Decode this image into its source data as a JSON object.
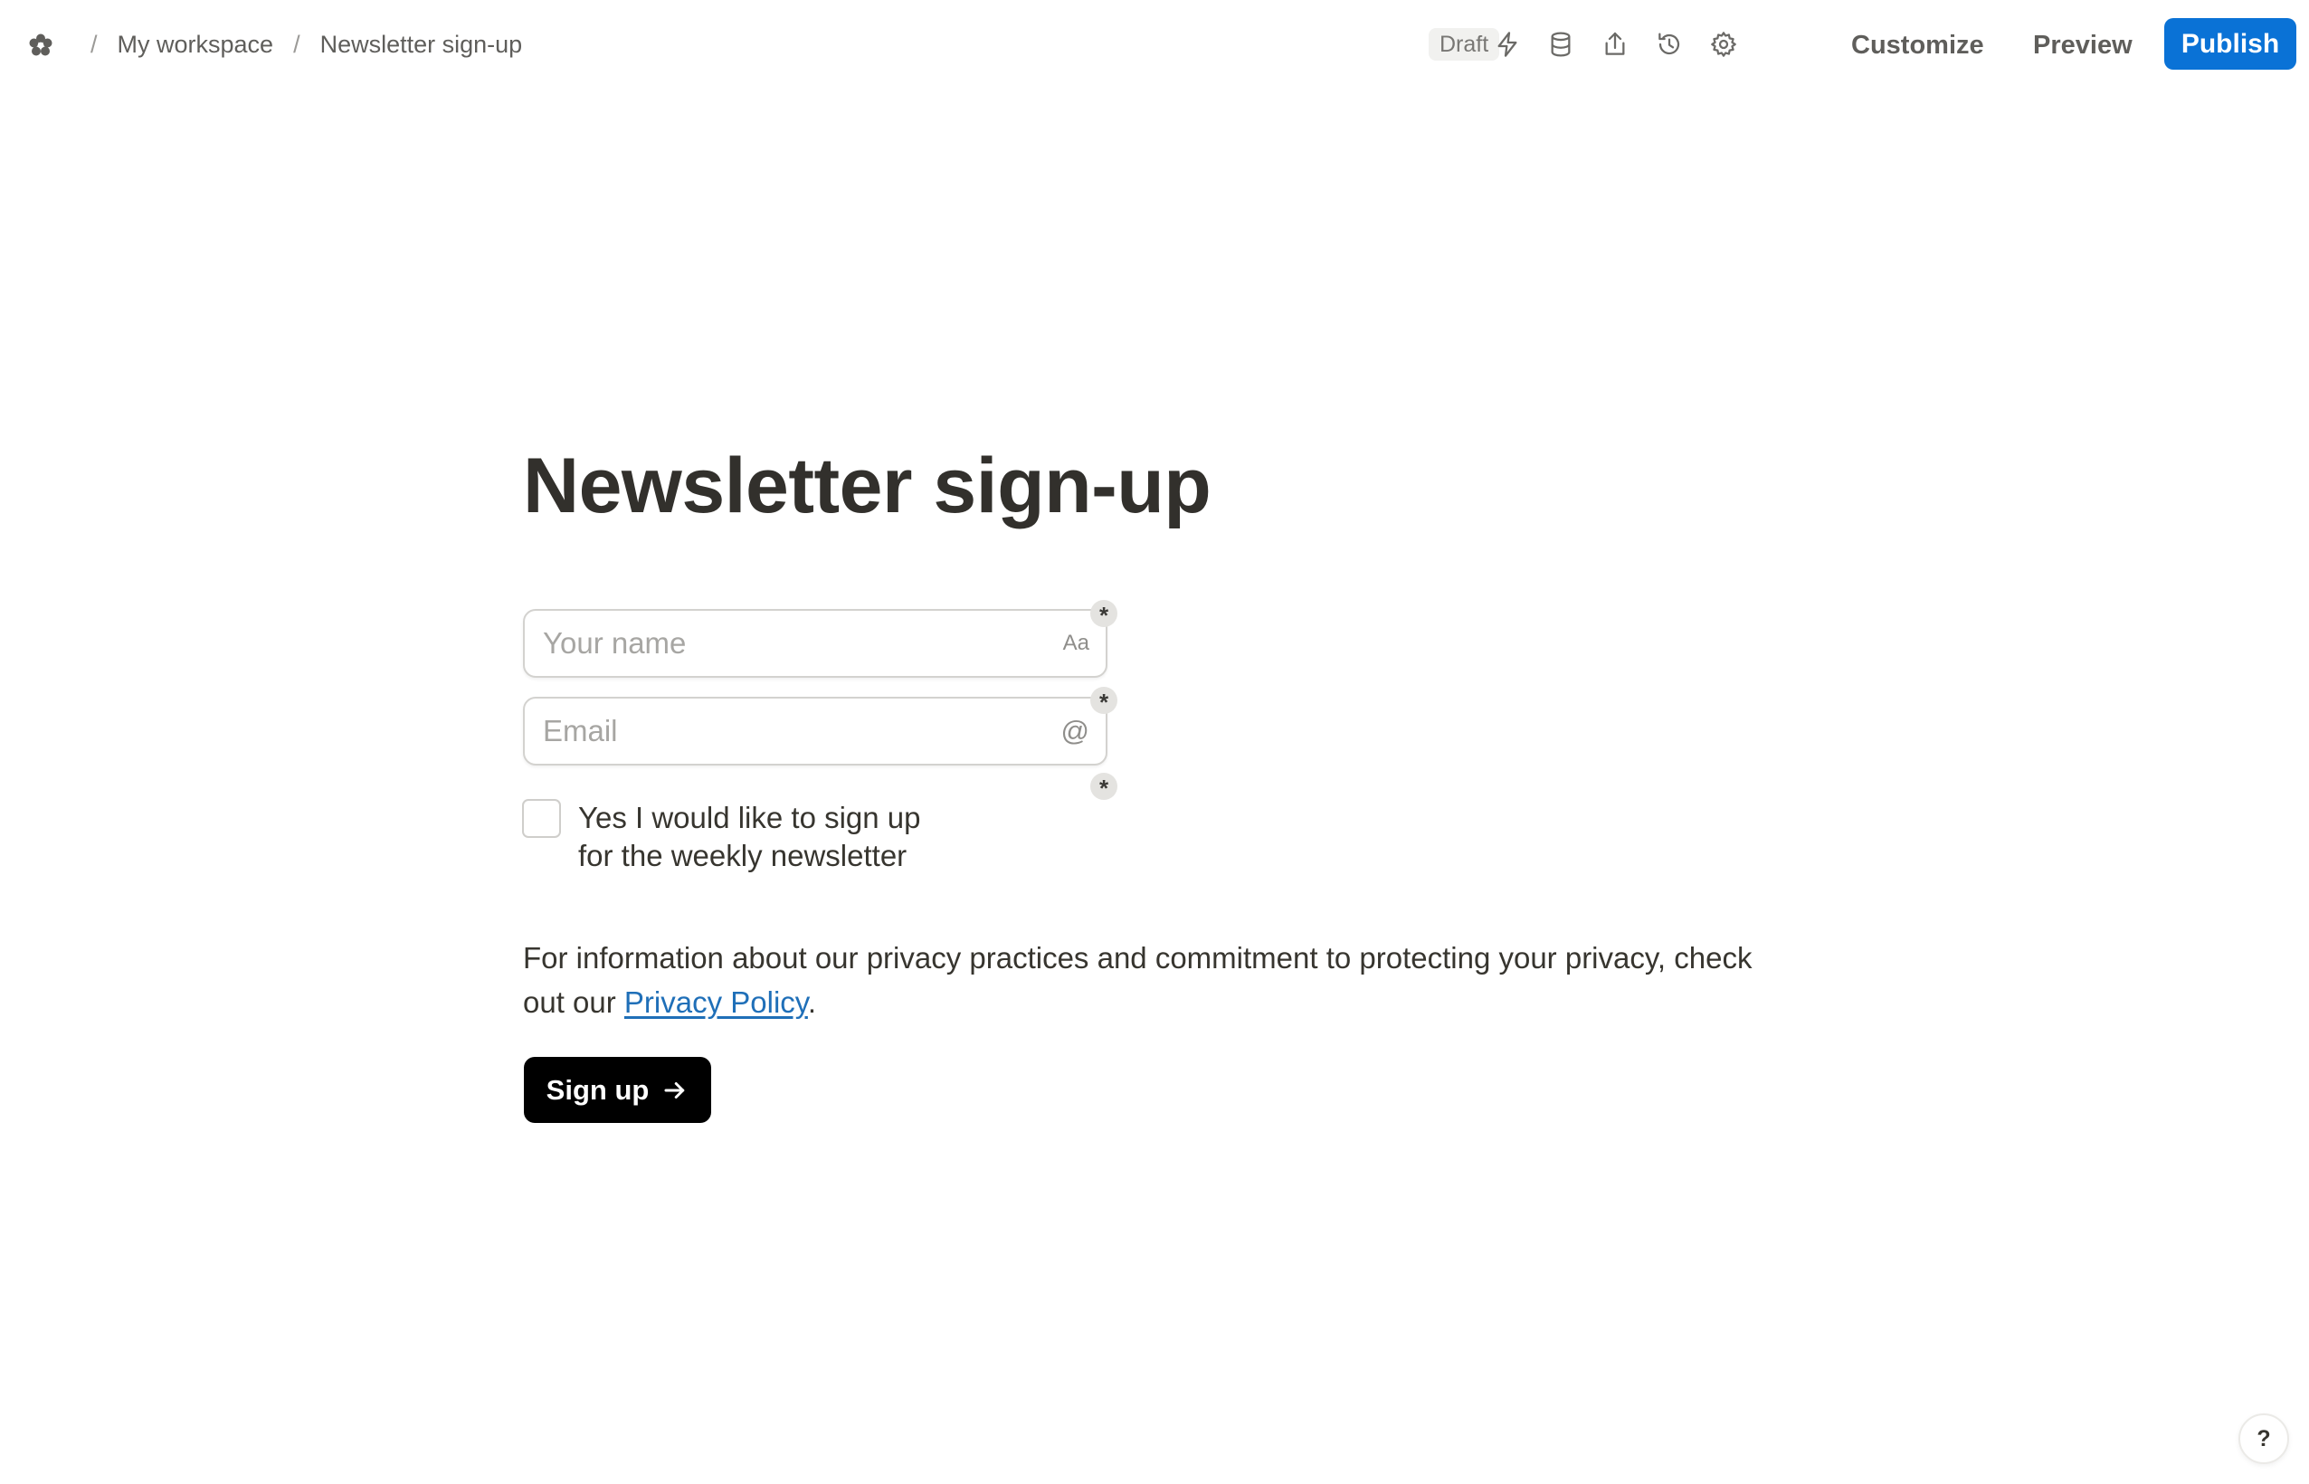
{
  "breadcrumb": {
    "separator": "/",
    "workspace": "My workspace",
    "page": "Newsletter sign-up"
  },
  "toolbar": {
    "status": "Draft",
    "icons": [
      "bolt-icon",
      "database-icon",
      "share-icon",
      "history-icon",
      "gear-icon"
    ],
    "customize_label": "Customize",
    "preview_label": "Preview",
    "publish_label": "Publish",
    "publish_color": "#0a72d6"
  },
  "form": {
    "title": "Newsletter sign-up",
    "name_field": {
      "placeholder": "Your name",
      "icon_text": "Aa",
      "required_mark": "*"
    },
    "email_field": {
      "placeholder": "Email",
      "icon_text": "@",
      "required_mark": "*"
    },
    "consent": {
      "label": "Yes I would like to sign up for the weekly newsletter",
      "required_mark": "*",
      "checked": false
    },
    "privacy": {
      "text_before": "For information about our privacy practices and commitment to protecting your privacy, check out our ",
      "link_text": "Privacy Policy",
      "text_after": "."
    },
    "submit_label": "Sign up"
  },
  "help": {
    "label": "?"
  }
}
